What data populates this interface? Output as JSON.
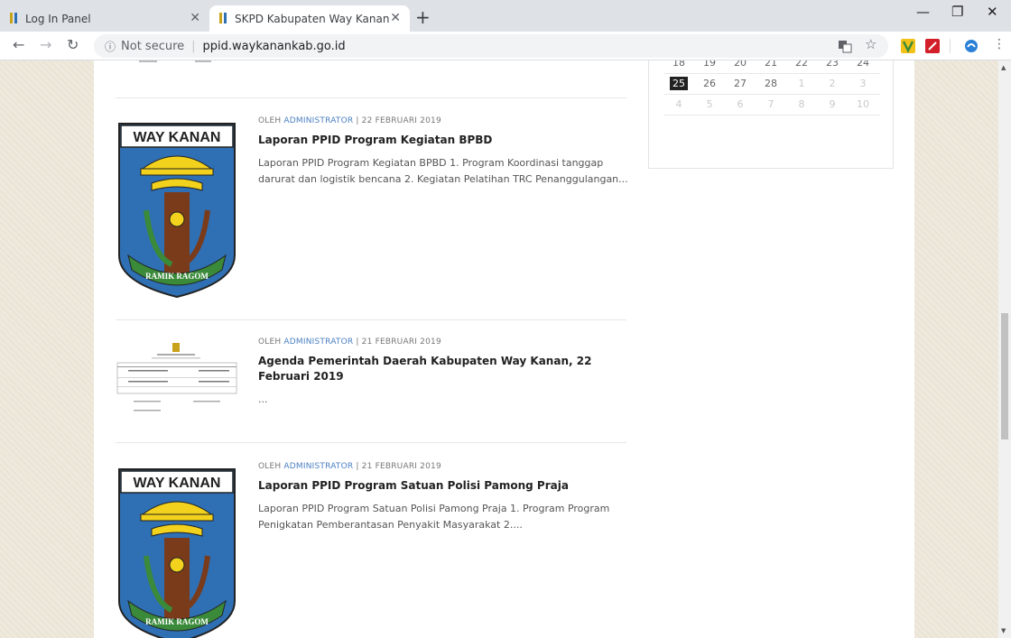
{
  "browser": {
    "tabs": [
      {
        "title": "Log In Panel",
        "active": false
      },
      {
        "title": "SKPD Kabupaten Way Kanan",
        "active": true
      }
    ],
    "security_label": "Not secure",
    "url": "ppid.waykanankab.go.id"
  },
  "calendar": {
    "rows": [
      [
        {
          "d": "18"
        },
        {
          "d": "19"
        },
        {
          "d": "20"
        },
        {
          "d": "21"
        },
        {
          "d": "22"
        },
        {
          "d": "23"
        },
        {
          "d": "24"
        }
      ],
      [
        {
          "d": "25",
          "today": true
        },
        {
          "d": "26"
        },
        {
          "d": "27"
        },
        {
          "d": "28"
        },
        {
          "d": "1",
          "muted": true
        },
        {
          "d": "2",
          "muted": true
        },
        {
          "d": "3",
          "muted": true
        }
      ],
      [
        {
          "d": "4",
          "muted": true
        },
        {
          "d": "5",
          "muted": true
        },
        {
          "d": "6",
          "muted": true
        },
        {
          "d": "7",
          "muted": true
        },
        {
          "d": "8",
          "muted": true
        },
        {
          "d": "9",
          "muted": true
        },
        {
          "d": "10",
          "muted": true
        }
      ]
    ]
  },
  "posts": [
    {
      "meta_prefix": "OLEH",
      "author": "ADMINISTRATOR",
      "date": "| 22 FEBRUARI 2019",
      "title": "Laporan PPID Program Kegiatan BPBD",
      "excerpt": "Laporan PPID Program Kegiatan  BPBD 1. Program Koordinasi tanggap darurat dan logistik bencana 2. Kegiatan Pelatihan TRC Penanggulangan...",
      "thumb": "logo",
      "logo_text": "WAY KANAN",
      "logo_motto": "RAMIK RAGOM"
    },
    {
      "meta_prefix": "OLEH",
      "author": "ADMINISTRATOR",
      "date": "| 21 FEBRUARI 2019",
      "title": "Agenda Pemerintah Daerah Kabupaten Way Kanan, 22 Februari 2019",
      "excerpt": "...",
      "thumb": "document"
    },
    {
      "meta_prefix": "OLEH",
      "author": "ADMINISTRATOR",
      "date": "| 21 FEBRUARI 2019",
      "title": "Laporan PPID Program Satuan Polisi Pamong Praja",
      "excerpt": " Laporan  PPID Program  Satuan Polisi Pamong Praja 1. Program Program Penigkatan Pemberantasan Penyakit Masyarakat 2....",
      "thumb": "logo",
      "logo_text": "WAY KANAN",
      "logo_motto": "RAMIK RAGOM"
    }
  ],
  "colors": {
    "accent": "#4a7fc1",
    "logo_blue": "#2f6fb3",
    "logo_green": "#3a8a3a",
    "logo_yellow": "#f2d21c",
    "logo_brown": "#7a3b1a"
  }
}
